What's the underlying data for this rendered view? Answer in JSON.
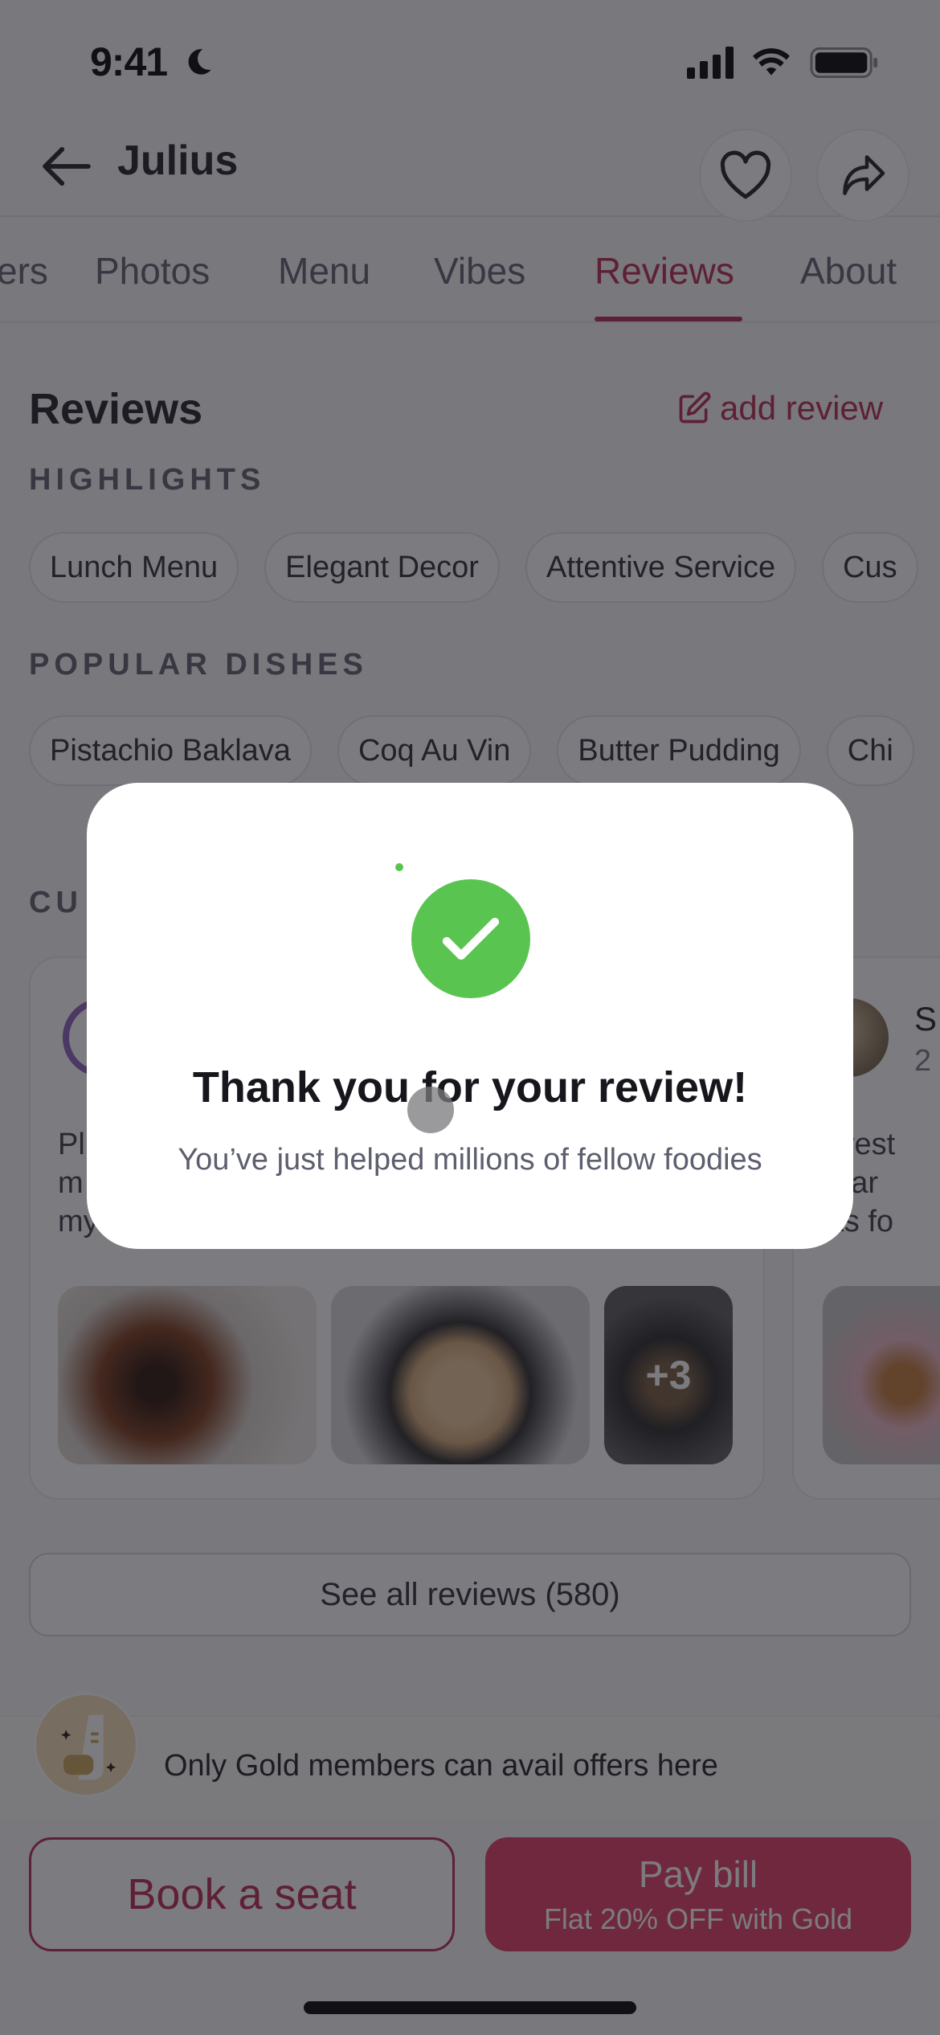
{
  "status_bar": {
    "time": "9:41"
  },
  "header": {
    "title": "Julius"
  },
  "tabs": [
    {
      "label": "Offers",
      "visible_text": "ers"
    },
    {
      "label": "Photos"
    },
    {
      "label": "Menu"
    },
    {
      "label": "Vibes"
    },
    {
      "label": "Reviews",
      "active": true
    },
    {
      "label": "About"
    }
  ],
  "reviews": {
    "title": "Reviews",
    "add_review_label": "add review",
    "highlights_label": "HIGHLIGHTS",
    "highlights": [
      "Lunch Menu",
      "Elegant Decor",
      "Attentive Service",
      "Cus"
    ],
    "popular_dishes_label": "POPULAR DISHES",
    "popular_dishes": [
      "Pistachio Baklava",
      "Coq Au Vin",
      "Butter Pudding",
      "Chi"
    ],
    "customer_section_label": "CU",
    "cards": [
      {
        "text_lines": [
          "Pl",
          "m",
          "my"
        ],
        "more_photos": "+3"
      },
      {
        "name_initial": "S",
        "meta_initial": "2",
        "text_lines": [
          "he rest",
          "aesar",
          "arks fo"
        ]
      }
    ],
    "see_all_label": "See all reviews (580)"
  },
  "gold_bar": {
    "text": "Only Gold members can avail offers here"
  },
  "actions": {
    "book_label": "Book a seat",
    "pay_label": "Pay bill",
    "pay_sublabel": "Flat 20% OFF with Gold"
  },
  "modal": {
    "title": "Thank you for your review!",
    "subtitle": "You’ve just helped millions of fellow foodies"
  },
  "colors": {
    "brand": "#b8274e",
    "success": "#5ac451",
    "pay_button": "#e13b63"
  }
}
